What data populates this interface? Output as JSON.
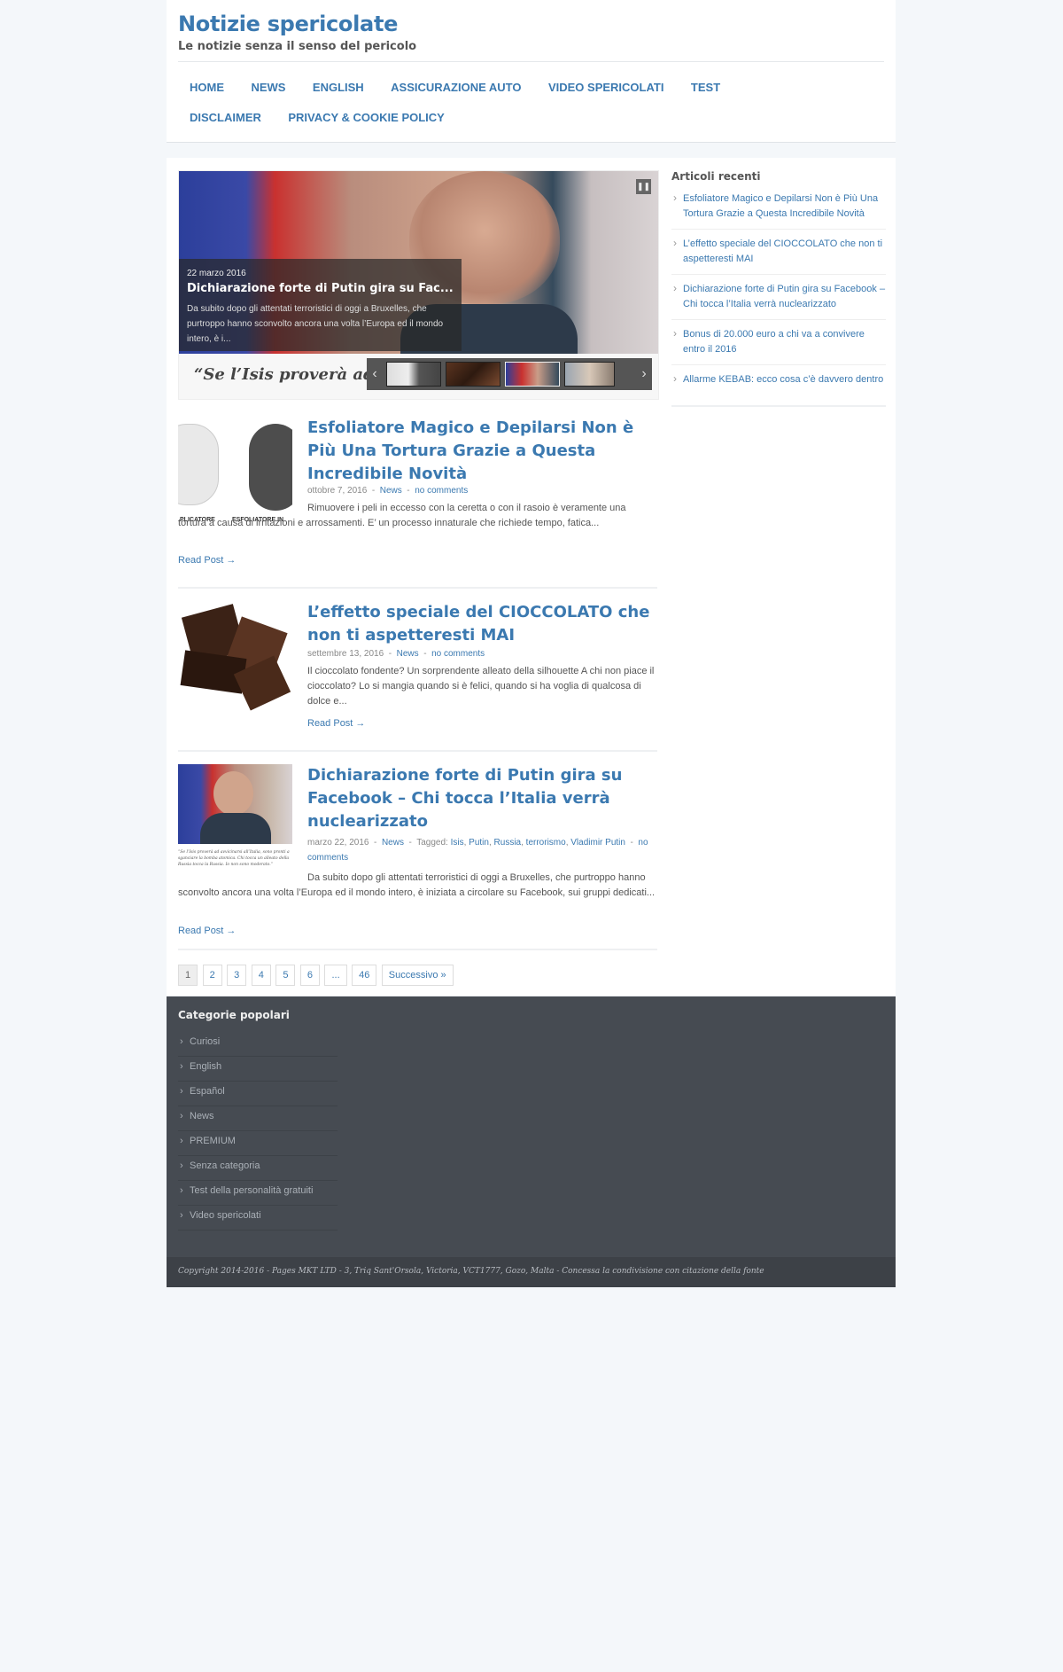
{
  "site": {
    "title": "Notizie spericolate",
    "tagline": "Le notizie senza il senso del pericolo"
  },
  "nav": [
    "HOME",
    "NEWS",
    "ENGLISH",
    "ASSICURAZIONE AUTO",
    "VIDEO SPERICOLATI",
    "TEST",
    "DISCLAIMER",
    "PRIVACY & COOKIE POLICY"
  ],
  "slider": {
    "date": "22 marzo 2016",
    "title": "Dichiarazione forte di Putin gira su Fac...",
    "text": "Da subito dopo gli attentati terroristici di oggi a Bruxelles, che purtroppo hanno sconvolto ancora una volta l’Europa ed il mondo intero, è i...",
    "strip_text": "“Se l’Isis proverà ad a",
    "pause_icon": "pause-icon",
    "prev_icon": "chevron-left-icon",
    "next_icon": "chevron-right-icon"
  },
  "posts": [
    {
      "title": "Esfoliatore Magico e Depilarsi Non è Più Una Tortura Grazie a Questa Incredibile Novità",
      "date": "ottobre 7, 2016",
      "category": "News",
      "comments": "no comments",
      "excerpt": "Rimuovere i peli in eccesso con la ceretta o con il rasoio è veramente una tortura a causa di irritazioni e arrossamenti. E’ un processo innaturale che richiede tempo, fatica...",
      "read_more": "Read Post →",
      "thumb_caption_left": "PLICATORE",
      "thumb_caption_right": "ESFOLIATORE IN"
    },
    {
      "title": "L’effetto speciale del CIOCCOLATO che non ti aspetteresti MAI",
      "date": "settembre 13, 2016",
      "category": "News",
      "comments": "no comments",
      "excerpt": "Il cioccolato fondente? Un sorprendente alleato della silhouette A chi non piace il cioccolato? Lo si mangia quando si è felici, quando si ha voglia di qualcosa di dolce e...",
      "read_more": "Read Post →"
    },
    {
      "title": "Dichiarazione forte di Putin gira su Facebook – Chi tocca l’Italia verrà nuclearizzato",
      "date": "marzo 22, 2016",
      "category": "News",
      "tagged_label": "Tagged:",
      "tags": [
        "Isis",
        "Putin",
        "Russia",
        "terrorismo",
        "Vladimir Putin"
      ],
      "comments": "no comments",
      "excerpt": "Da subito dopo gli attentati terroristici di oggi a Bruxelles, che purtroppo hanno sconvolto ancora una volta l’Europa ed il mondo intero, è iniziata a circolare su Facebook, sui gruppi dedicati...",
      "read_more": "Read Post →",
      "thumb_caption": "“Se l’Isis proverà ad avvicinarsi all’Italia, sono pronti a sganciare la bomba atomica. Chi tocca un alleato della Russia tocca la Russia. Io non sono moderato.”"
    }
  ],
  "pagination": [
    "1",
    "2",
    "3",
    "4",
    "5",
    "6",
    "...",
    "46",
    "Successivo »"
  ],
  "sidebar": {
    "title": "Articoli recenti",
    "items": [
      "Esfoliatore Magico e Depilarsi Non è Più Una Tortura Grazie a Questa Incredibile Novità",
      "L’effetto speciale del CIOCCOLATO che non ti aspetteresti MAI",
      "Dichiarazione forte di Putin gira su Facebook – Chi tocca l’Italia verrà nuclearizzato",
      "Bonus di 20.000 euro a chi va a convivere entro il 2016",
      "Allarme KEBAB: ecco cosa c’è davvero dentro"
    ]
  },
  "footer": {
    "title": "Categorie popolari",
    "categories": [
      "Curiosi",
      "English",
      "Español",
      "News",
      "PREMIUM",
      "Senza categoria",
      "Test della personalità gratuiti",
      "Video spericolati"
    ],
    "copyright": "Copyright 2014-2016 - Pages MKT LTD - 3, Triq Sant'Orsola, Victoria, VCT1777, Gozo, Malta - Concessa la condivisione con citazione della fonte"
  },
  "colors": {
    "link": "#3b79b0",
    "footer_bg": "#464b52",
    "page_bg": "#f4f7fa"
  }
}
